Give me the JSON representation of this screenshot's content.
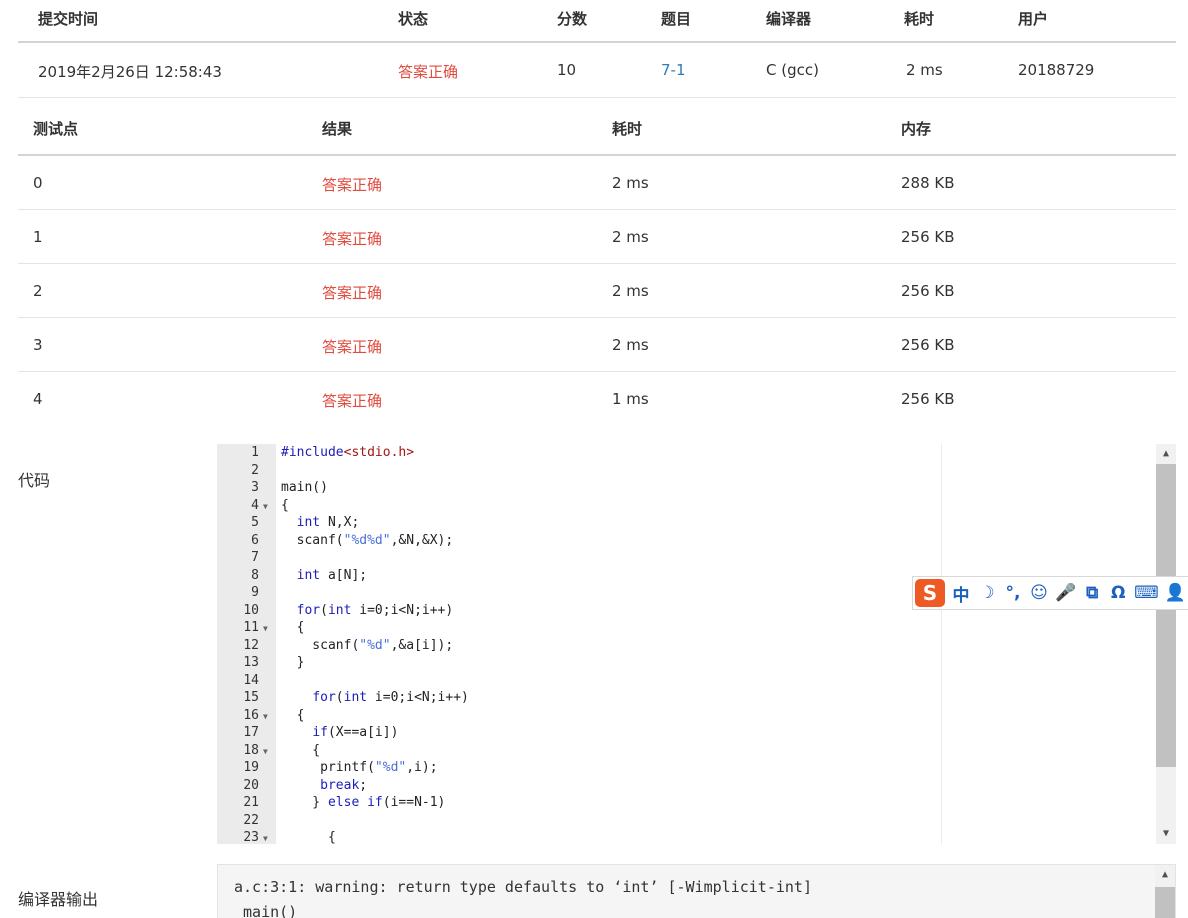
{
  "submission": {
    "headers": [
      "提交时间",
      "状态",
      "分数",
      "题目",
      "编译器",
      "耗时",
      "用户"
    ],
    "row": {
      "time": "2019年2月26日 12:58:43",
      "status": "答案正确",
      "score": "10",
      "problem": "7-1",
      "compiler": "C (gcc)",
      "elapsed": "2 ms",
      "user": "20188729"
    }
  },
  "testcases": {
    "headers": [
      "测试点",
      "结果",
      "耗时",
      "内存"
    ],
    "rows": [
      {
        "id": "0",
        "result": "答案正确",
        "time": "2 ms",
        "memory": "288 KB"
      },
      {
        "id": "1",
        "result": "答案正确",
        "time": "2 ms",
        "memory": "256 KB"
      },
      {
        "id": "2",
        "result": "答案正确",
        "time": "2 ms",
        "memory": "256 KB"
      },
      {
        "id": "3",
        "result": "答案正确",
        "time": "2 ms",
        "memory": "256 KB"
      },
      {
        "id": "4",
        "result": "答案正确",
        "time": "1 ms",
        "memory": "256 KB"
      }
    ]
  },
  "code_section": {
    "label": "代码",
    "lines": [
      "#include<stdio.h>",
      "",
      "main()",
      "{",
      "  int N,X;",
      "  scanf(\"%d%d\",&N,&X);",
      "",
      "  int a[N];",
      "",
      "  for(int i=0;i<N;i++)",
      "  {",
      "    scanf(\"%d\",&a[i]);",
      "  }",
      "",
      "    for(int i=0;i<N;i++)",
      "  {",
      "    if(X==a[i])",
      "    {",
      "     printf(\"%d\",i);",
      "     break;",
      "    } else if(i==N-1)",
      "",
      "      {"
    ],
    "fold_lines": [
      4,
      11,
      16,
      18,
      23
    ]
  },
  "ime_toolbar": {
    "logo": "S",
    "items": [
      "中",
      "☽",
      "°,",
      "☺",
      "🎤",
      "⧉",
      "Ω",
      "⌨",
      "👤"
    ]
  },
  "compiler_output": {
    "label": "编译器输出",
    "lines": [
      "a.c:3:1: warning: return type defaults to ‘int’ [-Wimplicit-int]",
      " main()"
    ]
  },
  "colors": {
    "accent_red": "#e14c40",
    "link_blue": "#337ab7"
  }
}
